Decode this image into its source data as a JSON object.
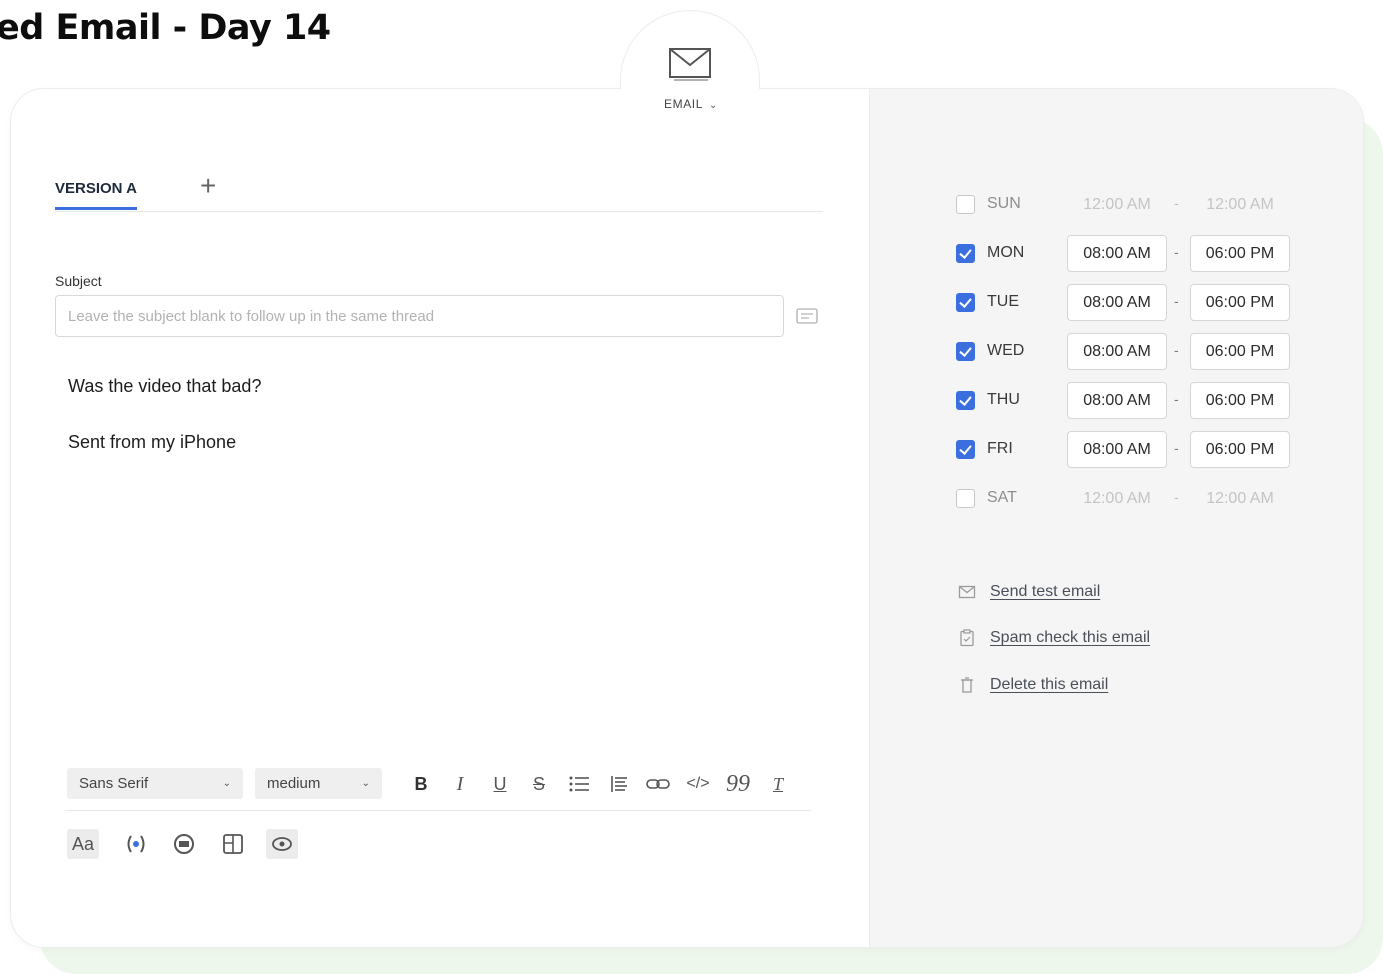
{
  "page": {
    "title": "ed Email - Day 14"
  },
  "step_type": {
    "label": "EMAIL",
    "icon": "envelope-icon"
  },
  "editor": {
    "tabs": [
      {
        "label": "VERSION A"
      }
    ],
    "add_tab_label": "+",
    "subject_label": "Subject",
    "subject_placeholder": "Leave the subject blank to follow up in the same thread",
    "subject_value": "",
    "body_lines": [
      "Was the video that bad?",
      "Sent from my iPhone"
    ]
  },
  "toolbar": {
    "font_family": "Sans Serif",
    "font_size": "medium",
    "buttons": [
      "bold-icon",
      "italic-icon",
      "underline-icon",
      "strikethrough-icon",
      "bullet-list-icon",
      "ordered-list-icon",
      "link-icon",
      "code-icon",
      "quote-icon",
      "clear-format-icon"
    ],
    "row2": {
      "text_style": "Aa",
      "buttons": [
        "variable-icon",
        "signature-icon",
        "image-icon",
        "preview-icon"
      ]
    }
  },
  "schedule": {
    "days": [
      {
        "name": "SUN",
        "enabled": false,
        "start": "12:00 AM",
        "end": "12:00 AM"
      },
      {
        "name": "MON",
        "enabled": true,
        "start": "08:00 AM",
        "end": "06:00 PM"
      },
      {
        "name": "TUE",
        "enabled": true,
        "start": "08:00 AM",
        "end": "06:00 PM"
      },
      {
        "name": "WED",
        "enabled": true,
        "start": "08:00 AM",
        "end": "06:00 PM"
      },
      {
        "name": "THU",
        "enabled": true,
        "start": "08:00 AM",
        "end": "06:00 PM"
      },
      {
        "name": "FRI",
        "enabled": true,
        "start": "08:00 AM",
        "end": "06:00 PM"
      },
      {
        "name": "SAT",
        "enabled": false,
        "start": "12:00 AM",
        "end": "12:00 AM"
      }
    ],
    "separator": "-"
  },
  "actions": [
    {
      "label": "Send test email",
      "icon": "mail-icon"
    },
    {
      "label": "Spam check this email",
      "icon": "clipboard-icon"
    },
    {
      "label": "Delete this email",
      "icon": "trash-icon"
    }
  ],
  "colors": {
    "accent": "#3b6fe0",
    "panel": "#f5f5f5",
    "background_accent": "#eef7ec"
  }
}
